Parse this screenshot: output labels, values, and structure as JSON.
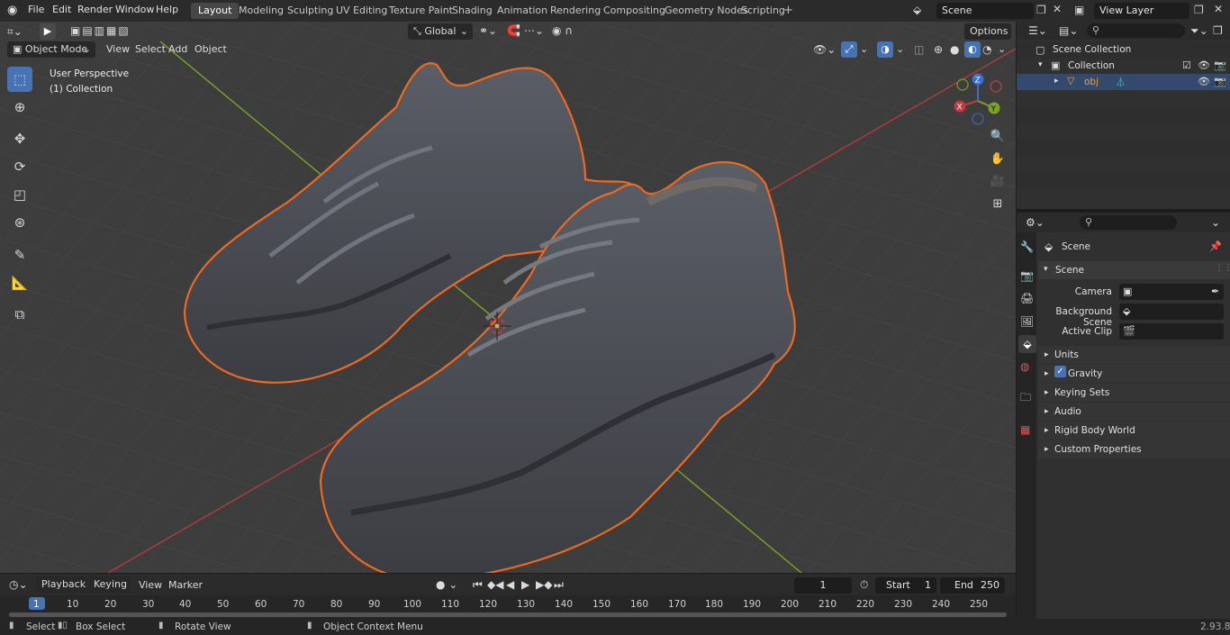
{
  "menu": [
    "File",
    "Edit",
    "Render",
    "Window",
    "Help"
  ],
  "workspaces": [
    "Layout",
    "Modeling",
    "Sculpting",
    "UV Editing",
    "Texture Paint",
    "Shading",
    "Animation",
    "Rendering",
    "Compositing",
    "Geometry Nodes",
    "Scripting"
  ],
  "active_workspace": "Layout",
  "scene_field": "Scene",
  "view_layer_field": "View Layer",
  "viewport": {
    "mode": "Object Mode",
    "menus": [
      "View",
      "Select",
      "Add",
      "Object"
    ],
    "transform_orientation": "Global",
    "options_label": "Options",
    "perspective_label": "User Perspective",
    "collection_label": "(1) Collection",
    "gizmo_axes": [
      "Z",
      "Y",
      "X"
    ]
  },
  "outliner": {
    "scene_collection": "Scene Collection",
    "collection": "Collection",
    "object": "obj"
  },
  "properties": {
    "context": "Scene",
    "panel": "Scene",
    "fields": [
      {
        "label": "Camera"
      },
      {
        "label": "Background Scene"
      },
      {
        "label": "Active Clip"
      }
    ],
    "subpanels": [
      "Units",
      "Gravity",
      "Keying Sets",
      "Audio",
      "Rigid Body World",
      "Custom Properties"
    ]
  },
  "timeline": {
    "menus": [
      "Playback",
      "Keying",
      "View",
      "Marker"
    ],
    "current_frame": "1",
    "start_label": "Start",
    "start_value": "1",
    "end_label": "End",
    "end_value": "250",
    "ticks": [
      "1",
      "10",
      "20",
      "30",
      "40",
      "50",
      "60",
      "70",
      "80",
      "90",
      "100",
      "110",
      "120",
      "130",
      "140",
      "150",
      "160",
      "170",
      "180",
      "190",
      "200",
      "210",
      "220",
      "230",
      "240",
      "250"
    ]
  },
  "statusbar": {
    "select": "Select",
    "box_select": "Box Select",
    "rotate_view": "Rotate View",
    "context_menu": "Object Context Menu",
    "version": "2.93.8"
  },
  "colors": {
    "accent": "#4772b3",
    "selection_outline": "#f0691e",
    "axis_x": "#c33a3a",
    "axis_y": "#7aa427",
    "axis_z": "#3a6fd1"
  }
}
